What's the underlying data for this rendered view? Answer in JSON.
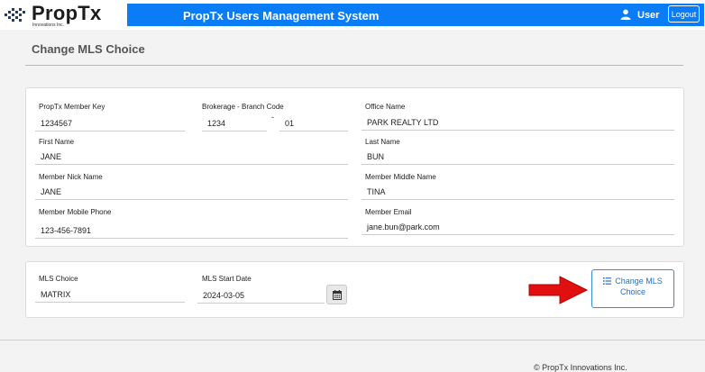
{
  "header": {
    "logo_name": "PropTx",
    "logo_sub": "Innovations Inc.",
    "system_title": "PropTx Users Management System",
    "user_label": "User",
    "logout_label": "Logout",
    "banner_color": "#0a7cf6"
  },
  "page": {
    "title": "Change MLS Choice"
  },
  "member": {
    "member_key_label": "PropTx Member Key",
    "member_key": "1234567",
    "brokerage_label": "Brokerage - Branch Code",
    "brokerage_code": "1234",
    "branch_separator": "-",
    "branch_code": "01",
    "office_name_label": "Office Name",
    "office_name": "PARK REALTY LTD",
    "first_name_label": "First Name",
    "first_name": "JANE",
    "last_name_label": "Last Name",
    "last_name": "BUN",
    "nick_name_label": "Member Nick Name",
    "nick_name": "JANE",
    "middle_name_label": "Member Middle Name",
    "middle_name": "TINA",
    "mobile_label": "Member Mobile Phone",
    "mobile": "123-456-7891",
    "email_label": "Member Email",
    "email": "jane.bun@park.com"
  },
  "mls": {
    "choice_label": "MLS Choice",
    "choice_value": "MATRIX",
    "start_date_label": "MLS Start Date",
    "start_date_value": "2024-03-05",
    "change_button_line1": "Change MLS",
    "change_button_line2": "Choice"
  },
  "footer": {
    "copyright": "© PropTx Innovations Inc."
  },
  "icons": {
    "user": "user-icon",
    "calendar": "calendar-icon",
    "list": "list-icon",
    "arrow": "red-arrow-icon"
  }
}
